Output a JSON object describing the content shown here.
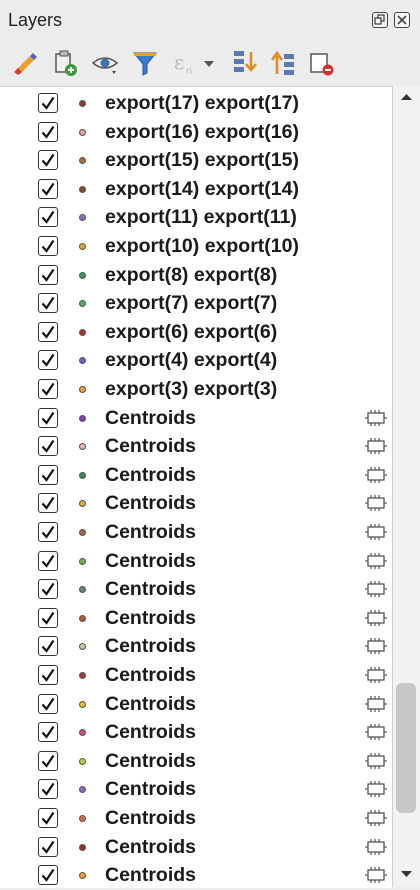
{
  "panel": {
    "title": "Layers"
  },
  "window_buttons": [
    {
      "name": "float-panel-button",
      "icon": "float-icon"
    },
    {
      "name": "close-panel-button",
      "icon": "close-icon"
    }
  ],
  "toolbar": [
    {
      "name": "style-manager-button",
      "icon": "paintbrush-icon"
    },
    {
      "name": "add-group-button",
      "icon": "add-group-icon"
    },
    {
      "name": "visibility-button",
      "icon": "eye-icon"
    },
    {
      "name": "filter-legend-button",
      "icon": "funnel-icon"
    },
    {
      "name": "filter-expression-button",
      "icon": "expression-filter-icon"
    },
    {
      "name": "expand-all-button",
      "icon": "expand-all-icon"
    },
    {
      "name": "collapse-all-button",
      "icon": "collapse-all-icon"
    },
    {
      "name": "remove-layer-button",
      "icon": "remove-layer-icon"
    }
  ],
  "layers": [
    {
      "label": "export(17) export(17)",
      "checked": true,
      "color": "#8b3a2f",
      "memory": false
    },
    {
      "label": "export(16) export(16)",
      "checked": true,
      "color": "#e5a0a0",
      "memory": false
    },
    {
      "label": "export(15) export(15)",
      "checked": true,
      "color": "#a86b3c",
      "memory": false
    },
    {
      "label": "export(14) export(14)",
      "checked": true,
      "color": "#8a4a2a",
      "memory": false
    },
    {
      "label": "export(11) export(11)",
      "checked": true,
      "color": "#8b6bbf",
      "memory": false
    },
    {
      "label": "export(10) export(10)",
      "checked": true,
      "color": "#e8a020",
      "memory": false
    },
    {
      "label": "export(8) export(8)",
      "checked": true,
      "color": "#3a9a5a",
      "memory": false
    },
    {
      "label": "export(7) export(7)",
      "checked": true,
      "color": "#55aa66",
      "memory": false
    },
    {
      "label": "export(6) export(6)",
      "checked": true,
      "color": "#b03030",
      "memory": false
    },
    {
      "label": "export(4) export(4)",
      "checked": true,
      "color": "#7a5cc0",
      "memory": false
    },
    {
      "label": "export(3) export(3)",
      "checked": true,
      "color": "#f0a030",
      "memory": false
    },
    {
      "label": "Centroids",
      "checked": true,
      "color": "#8040b0",
      "memory": true
    },
    {
      "label": "Centroids",
      "checked": true,
      "color": "#e8b0b0",
      "memory": true
    },
    {
      "label": "Centroids",
      "checked": true,
      "color": "#3a8a5a",
      "memory": true
    },
    {
      "label": "Centroids",
      "checked": true,
      "color": "#e0b030",
      "memory": true
    },
    {
      "label": "Centroids",
      "checked": true,
      "color": "#9a6a4a",
      "memory": true
    },
    {
      "label": "Centroids",
      "checked": true,
      "color": "#70b050",
      "memory": true
    },
    {
      "label": "Centroids",
      "checked": true,
      "color": "#5a8a6a",
      "memory": true
    },
    {
      "label": "Centroids",
      "checked": true,
      "color": "#b05a2a",
      "memory": true
    },
    {
      "label": "Centroids",
      "checked": true,
      "color": "#c8c890",
      "memory": true
    },
    {
      "label": "Centroids",
      "checked": true,
      "color": "#a03a3a",
      "memory": true
    },
    {
      "label": "Centroids",
      "checked": true,
      "color": "#e0c020",
      "memory": true
    },
    {
      "label": "Centroids",
      "checked": true,
      "color": "#d04a7a",
      "memory": true
    },
    {
      "label": "Centroids",
      "checked": true,
      "color": "#b0d040",
      "memory": true
    },
    {
      "label": "Centroids",
      "checked": true,
      "color": "#8a6ac0",
      "memory": true
    },
    {
      "label": "Centroids",
      "checked": true,
      "color": "#d07040",
      "memory": true
    },
    {
      "label": "Centroids",
      "checked": true,
      "color": "#a02a2a",
      "memory": true
    },
    {
      "label": "Centroids",
      "checked": true,
      "color": "#f0a020",
      "memory": true
    }
  ],
  "scrollbar": {
    "position_fraction": 0.92
  }
}
